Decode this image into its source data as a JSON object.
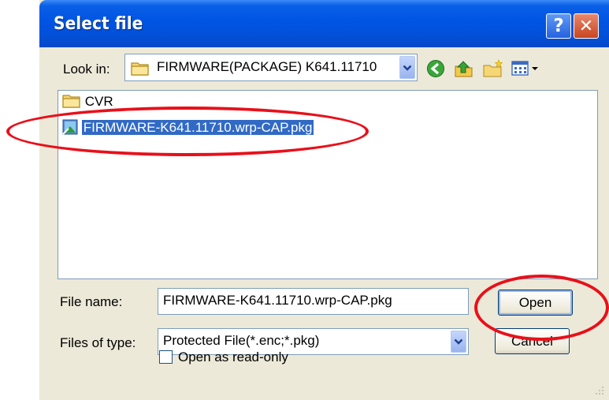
{
  "window": {
    "title": "Select file",
    "help_label": "?",
    "close_label": "✕"
  },
  "lookin": {
    "label": "Look in:",
    "value": "FIRMWARE(PACKAGE) K641.11710"
  },
  "files": [
    {
      "name": "CVR",
      "kind": "folder"
    },
    {
      "name": "FIRMWARE-K641.11710.wrp-CAP.pkg",
      "kind": "package",
      "selected": true
    }
  ],
  "filename": {
    "label": "File name:",
    "value": "FIRMWARE-K641.11710.wrp-CAP.pkg"
  },
  "filetype": {
    "label": "Files of type:",
    "value": "Protected File(*.enc;*.pkg)"
  },
  "buttons": {
    "open": "Open",
    "cancel": "Cancel"
  },
  "readonly": {
    "label": "Open as read-only",
    "checked": false
  },
  "colors": {
    "titlebar": "#0054e3",
    "dialog": "#ece9d8",
    "selection": "#316ac5",
    "annotation": "#e8101a"
  },
  "icons": [
    "help-icon",
    "close-icon",
    "folder-icon",
    "back-icon",
    "up-folder-icon",
    "new-folder-icon",
    "view-menu-icon",
    "package-file-icon",
    "chevron-down-icon",
    "resize-grip-icon"
  ]
}
